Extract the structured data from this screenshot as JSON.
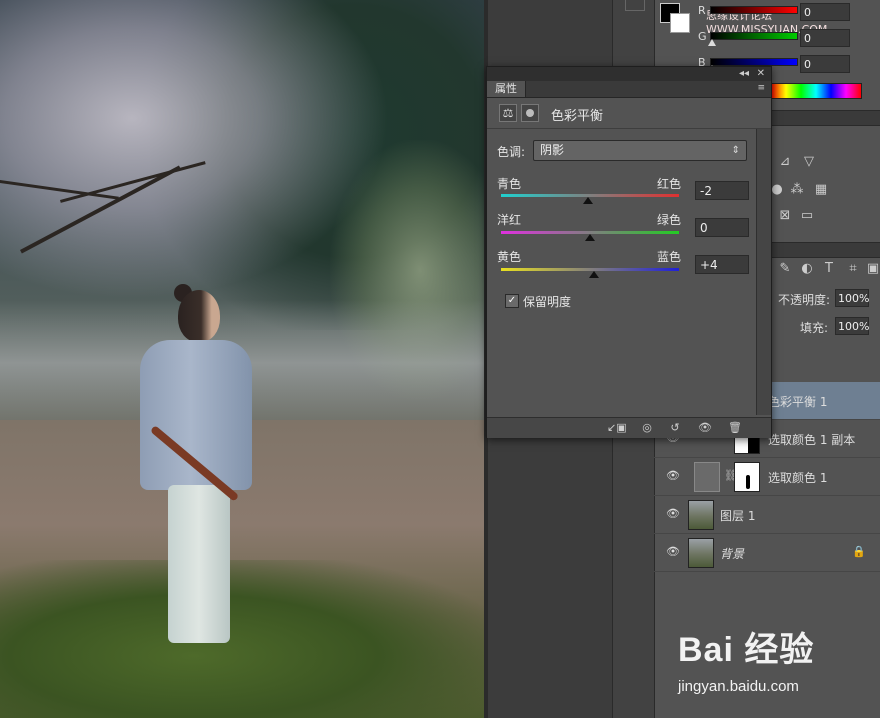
{
  "color_panel": {
    "channels": [
      {
        "label": "R",
        "value": "0"
      },
      {
        "label": "G",
        "value": "0"
      },
      {
        "label": "B",
        "value": "0"
      }
    ],
    "watermark_text": "思缘设计论坛 WWW.MISSYUAN.COM"
  },
  "properties": {
    "tab_label": "属性",
    "title": "色彩平衡",
    "tone_label": "色调:",
    "tone_value": "阴影",
    "sliders": [
      {
        "left": "青色",
        "right": "红色",
        "value": "-2",
        "level": -2,
        "colors": [
          "#1fd0cf",
          "#e03030"
        ]
      },
      {
        "left": "洋红",
        "right": "绿色",
        "value": "0",
        "level": 0,
        "colors": [
          "#e030e0",
          "#22cc22"
        ]
      },
      {
        "left": "黄色",
        "right": "蓝色",
        "value": "+4",
        "level": 4,
        "colors": [
          "#e8e020",
          "#2020d8"
        ]
      }
    ],
    "preserve_luminosity": "保留明度"
  },
  "layers": {
    "opacity_label": "不透明度:",
    "opacity_value": "100%",
    "fill_label": "填充:",
    "fill_value": "100%",
    "items": [
      {
        "name": "色彩平衡 1"
      },
      {
        "name": "选取颜色 1 副本"
      },
      {
        "name": "选取颜色 1"
      },
      {
        "name": "图层 1"
      },
      {
        "name": "背景"
      }
    ]
  },
  "watermark": {
    "brand": "Bai 经验",
    "url": "jingyan.baidu.com"
  },
  "colors": {
    "active_layer": "#6e7f92",
    "panel_bg": "#535353"
  }
}
